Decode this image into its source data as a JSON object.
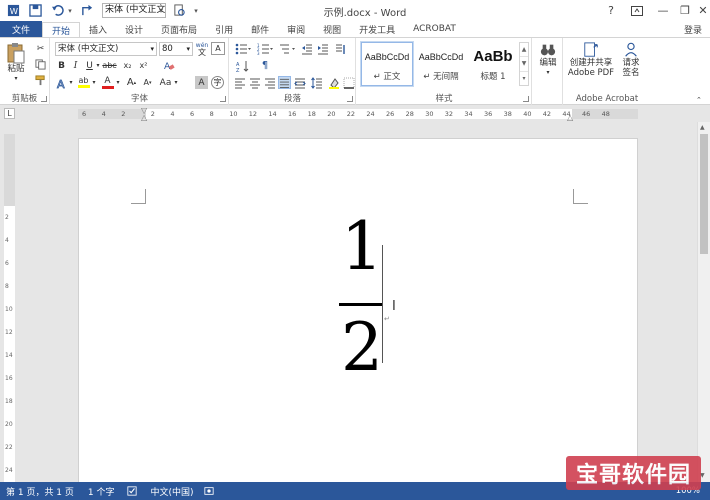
{
  "titlebar": {
    "doc_title": "示例.docx - Word",
    "font_quick": "宋体 (中文正文)",
    "help": "?",
    "minimize": "—",
    "restore": "❐",
    "close": "✕"
  },
  "tabs": {
    "file": "文件",
    "items": [
      "开始",
      "插入",
      "设计",
      "页面布局",
      "引用",
      "邮件",
      "审阅",
      "视图",
      "开发工具",
      "ACROBAT"
    ],
    "login": "登录"
  },
  "ribbon": {
    "clipboard": {
      "paste": "粘贴",
      "label": "剪贴板"
    },
    "font": {
      "name": "宋体 (中文正文)",
      "size": "80",
      "wen": "wén",
      "wen_char": "文",
      "label": "字体"
    },
    "paragraph": {
      "label": "段落"
    },
    "styles": {
      "label": "样式",
      "items": [
        {
          "sample": "AaBbCcDd",
          "name": "↵ 正文"
        },
        {
          "sample": "AaBbCcDd",
          "name": "↵ 无间隔"
        },
        {
          "sample": "AaBb",
          "name": "标题 1"
        }
      ]
    },
    "editing": {
      "label": "编辑"
    },
    "acrobat": {
      "label": "Adobe Acrobat",
      "create_share_line1": "创建并共享",
      "create_share_line2": "Adobe PDF",
      "request_line1": "请求",
      "request_line2": "签名"
    }
  },
  "ruler": {
    "corner": "L",
    "ticks": [
      "6",
      "4",
      "2",
      "2",
      "4",
      "6",
      "8",
      "10",
      "12",
      "14",
      "16",
      "18",
      "20",
      "22",
      "24",
      "26",
      "28",
      "30",
      "32",
      "34",
      "36",
      "38",
      "40",
      "42",
      "44",
      "46",
      "48"
    ],
    "vticks": [
      "2",
      "4",
      "6",
      "8",
      "10",
      "12",
      "14",
      "16",
      "18",
      "20",
      "22",
      "24"
    ]
  },
  "document": {
    "numerator": "1",
    "denominator": "2",
    "ibeam": "I",
    "para_mark": "↵"
  },
  "statusbar": {
    "page": "第 1 页，共 1 页",
    "words": "1 个字",
    "language": "中文(中国)",
    "zoom": "100%"
  },
  "watermark": "宝哥软件园"
}
